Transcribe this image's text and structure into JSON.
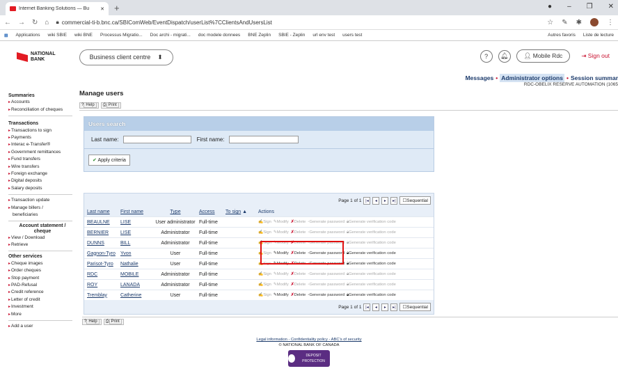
{
  "browser": {
    "tab_title": "Internet Banking Solutions — Bu",
    "url": "commercial-ti-b.bnc.ca/SBIComWeb/EventDispatch/userList%7CClientsAndUsersList",
    "bookmarks": [
      "Applications",
      "wiki SBIE",
      "wiki BNE",
      "Processus Migratio...",
      "Doc archi - migrati...",
      "doc modele donnees",
      "BNE Zeplin",
      "SBIE - Zeplin",
      "url env test",
      "users test"
    ],
    "bookmarks_right": [
      "Autres favoris",
      "Liste de lecture"
    ]
  },
  "header": {
    "logo_line1": "NATIONAL",
    "logo_line2": "BANK",
    "centre_select": "Business client centre",
    "help_icon": "?",
    "mobile_label": "Mobile Rdc",
    "signout": "Sign out"
  },
  "topnav": {
    "messages": "Messages",
    "admin": "Administrator options",
    "session": "Session summar"
  },
  "sidebar": {
    "summaries_title": "Summaries",
    "summaries": [
      "Accounts",
      "Reconciliation of cheques"
    ],
    "transactions_title": "Transactions",
    "transactions": [
      "Transactions to sign",
      "Payments",
      "Interac e-Transfer®",
      "Government remittances",
      "Fund transfers",
      "Wire transfers",
      "Foreign exchange",
      "Digital deposits",
      "Salary deposits"
    ],
    "more_tx": [
      "Transaction update",
      "Manage billers /",
      "beneficiaries"
    ],
    "stmt_title_1": "Account statement /",
    "stmt_title_2": "cheque",
    "stmt": [
      "View / Download",
      "Retrieve"
    ],
    "other_title": "Other services",
    "other": [
      "Cheque images",
      "Order cheques",
      "Stop payment",
      "PAD-Refusal",
      "Credit reference",
      "Letter of credit",
      "Investment",
      "More"
    ],
    "add_user": "Add a user"
  },
  "page": {
    "title": "Manage users",
    "company": "RDC-OBELIX RESERVE AUTOMATION (1065",
    "help": "Help",
    "print": "Print"
  },
  "search": {
    "title": "Users search",
    "last_name_label": "Last name:",
    "first_name_label": "First name:",
    "last_name_value": "",
    "first_name_value": "",
    "apply": "Apply criteria"
  },
  "table": {
    "pager": "Page 1 of 1",
    "sequential": "Sequential",
    "headers": {
      "last": "Last name",
      "first": "First name",
      "type": "Type",
      "access": "Access",
      "tosign": "To sign",
      "actions": "Actions"
    },
    "actions": {
      "sign": "Sign",
      "modify": "Modify",
      "delete": "Delete",
      "genpw": "Generate password",
      "genvc": "Generate verification code"
    },
    "rows": [
      {
        "last": "BEAULNE",
        "first": "LISE",
        "type": "User administrator",
        "access": "Full-time"
      },
      {
        "last": "BERNIER",
        "first": "LISE",
        "type": "Administrator",
        "access": "Full-time"
      },
      {
        "last": "DUNNS",
        "first": "BILL",
        "type": "Administrator",
        "access": "Full-time"
      },
      {
        "last": "Gagnon-Tyro",
        "first": "Yvon",
        "type": "User",
        "access": "Full-time"
      },
      {
        "last": "Parisot-Tyro",
        "first": "Nathalie",
        "type": "User",
        "access": "Full-time"
      },
      {
        "last": "RDC",
        "first": "MOBILE",
        "type": "Administrator",
        "access": "Full-time"
      },
      {
        "last": "ROY",
        "first": "LANADA",
        "type": "Administrator",
        "access": "Full-time"
      },
      {
        "last": "Tremblay",
        "first": "Catherine",
        "type": "User",
        "access": "Full-time"
      }
    ]
  },
  "footer": {
    "links": "Legal information - Confidentiality policy - ABC's of security",
    "copyright": "© NATIONAL BANK OF CANADA",
    "badge": "DEPOSIT PROTECTION"
  }
}
